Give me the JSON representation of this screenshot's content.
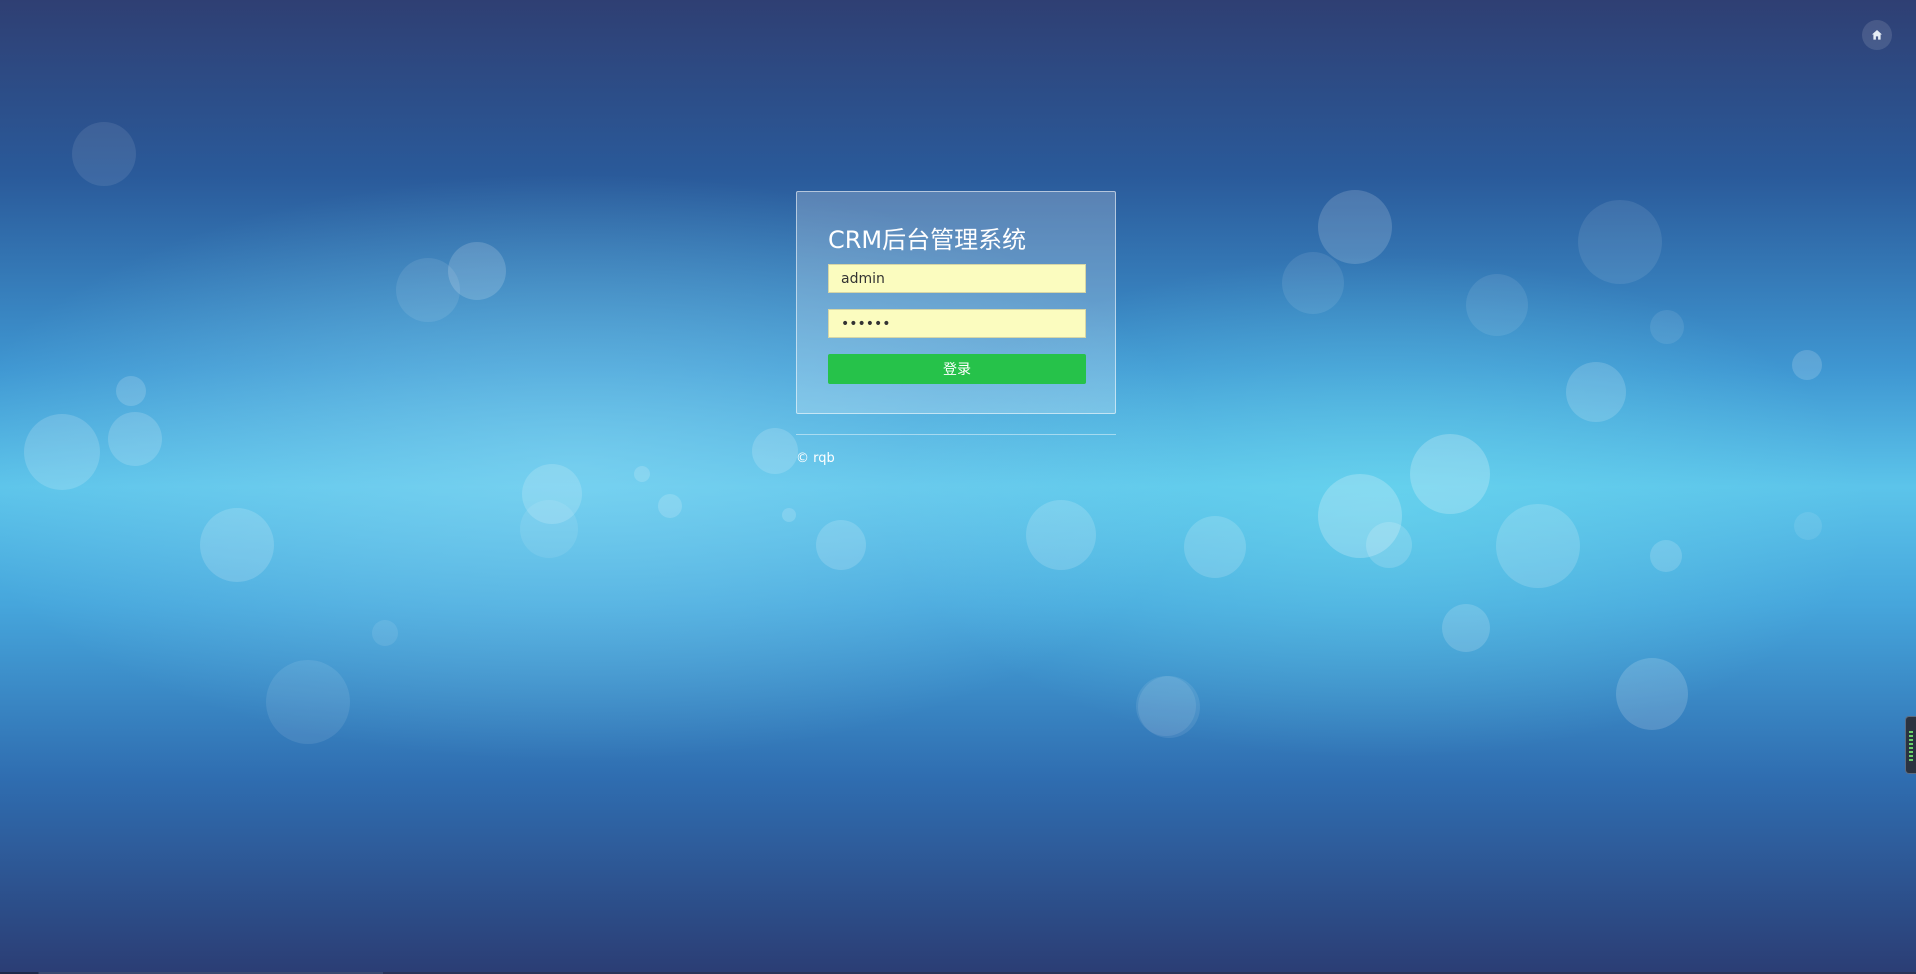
{
  "login": {
    "title": "CRM后台管理系统",
    "username_value": "admin",
    "password_value": "••••••",
    "submit_label": "登录"
  },
  "footer": {
    "copyright": "© rqb"
  },
  "toolbar": {
    "home_icon": "home-icon"
  },
  "colors": {
    "button_accent": "#26c24a",
    "input_fill": "#fbfcbf",
    "background_mid": "#5cc4ea"
  }
}
